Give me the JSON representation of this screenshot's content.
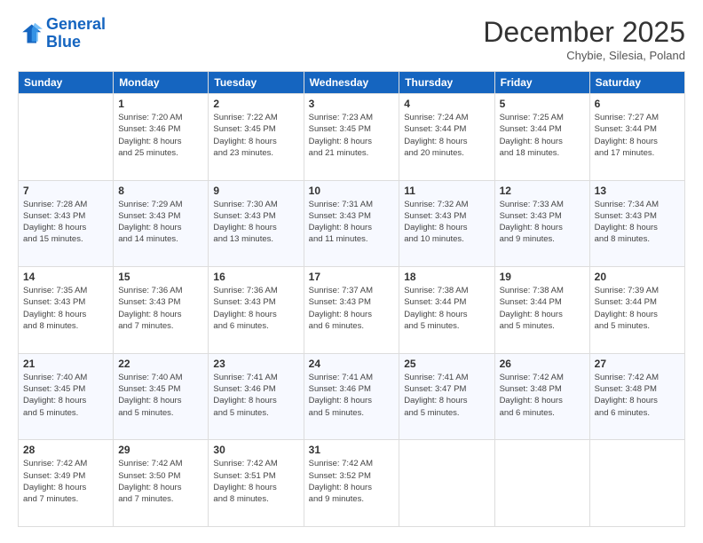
{
  "header": {
    "logo_line1": "General",
    "logo_line2": "Blue",
    "month_title": "December 2025",
    "location": "Chybie, Silesia, Poland"
  },
  "weekdays": [
    "Sunday",
    "Monday",
    "Tuesday",
    "Wednesday",
    "Thursday",
    "Friday",
    "Saturday"
  ],
  "weeks": [
    [
      {
        "day": "",
        "info": ""
      },
      {
        "day": "1",
        "info": "Sunrise: 7:20 AM\nSunset: 3:46 PM\nDaylight: 8 hours\nand 25 minutes."
      },
      {
        "day": "2",
        "info": "Sunrise: 7:22 AM\nSunset: 3:45 PM\nDaylight: 8 hours\nand 23 minutes."
      },
      {
        "day": "3",
        "info": "Sunrise: 7:23 AM\nSunset: 3:45 PM\nDaylight: 8 hours\nand 21 minutes."
      },
      {
        "day": "4",
        "info": "Sunrise: 7:24 AM\nSunset: 3:44 PM\nDaylight: 8 hours\nand 20 minutes."
      },
      {
        "day": "5",
        "info": "Sunrise: 7:25 AM\nSunset: 3:44 PM\nDaylight: 8 hours\nand 18 minutes."
      },
      {
        "day": "6",
        "info": "Sunrise: 7:27 AM\nSunset: 3:44 PM\nDaylight: 8 hours\nand 17 minutes."
      }
    ],
    [
      {
        "day": "7",
        "info": "Sunrise: 7:28 AM\nSunset: 3:43 PM\nDaylight: 8 hours\nand 15 minutes."
      },
      {
        "day": "8",
        "info": "Sunrise: 7:29 AM\nSunset: 3:43 PM\nDaylight: 8 hours\nand 14 minutes."
      },
      {
        "day": "9",
        "info": "Sunrise: 7:30 AM\nSunset: 3:43 PM\nDaylight: 8 hours\nand 13 minutes."
      },
      {
        "day": "10",
        "info": "Sunrise: 7:31 AM\nSunset: 3:43 PM\nDaylight: 8 hours\nand 11 minutes."
      },
      {
        "day": "11",
        "info": "Sunrise: 7:32 AM\nSunset: 3:43 PM\nDaylight: 8 hours\nand 10 minutes."
      },
      {
        "day": "12",
        "info": "Sunrise: 7:33 AM\nSunset: 3:43 PM\nDaylight: 8 hours\nand 9 minutes."
      },
      {
        "day": "13",
        "info": "Sunrise: 7:34 AM\nSunset: 3:43 PM\nDaylight: 8 hours\nand 8 minutes."
      }
    ],
    [
      {
        "day": "14",
        "info": "Sunrise: 7:35 AM\nSunset: 3:43 PM\nDaylight: 8 hours\nand 8 minutes."
      },
      {
        "day": "15",
        "info": "Sunrise: 7:36 AM\nSunset: 3:43 PM\nDaylight: 8 hours\nand 7 minutes."
      },
      {
        "day": "16",
        "info": "Sunrise: 7:36 AM\nSunset: 3:43 PM\nDaylight: 8 hours\nand 6 minutes."
      },
      {
        "day": "17",
        "info": "Sunrise: 7:37 AM\nSunset: 3:43 PM\nDaylight: 8 hours\nand 6 minutes."
      },
      {
        "day": "18",
        "info": "Sunrise: 7:38 AM\nSunset: 3:44 PM\nDaylight: 8 hours\nand 5 minutes."
      },
      {
        "day": "19",
        "info": "Sunrise: 7:38 AM\nSunset: 3:44 PM\nDaylight: 8 hours\nand 5 minutes."
      },
      {
        "day": "20",
        "info": "Sunrise: 7:39 AM\nSunset: 3:44 PM\nDaylight: 8 hours\nand 5 minutes."
      }
    ],
    [
      {
        "day": "21",
        "info": "Sunrise: 7:40 AM\nSunset: 3:45 PM\nDaylight: 8 hours\nand 5 minutes."
      },
      {
        "day": "22",
        "info": "Sunrise: 7:40 AM\nSunset: 3:45 PM\nDaylight: 8 hours\nand 5 minutes."
      },
      {
        "day": "23",
        "info": "Sunrise: 7:41 AM\nSunset: 3:46 PM\nDaylight: 8 hours\nand 5 minutes."
      },
      {
        "day": "24",
        "info": "Sunrise: 7:41 AM\nSunset: 3:46 PM\nDaylight: 8 hours\nand 5 minutes."
      },
      {
        "day": "25",
        "info": "Sunrise: 7:41 AM\nSunset: 3:47 PM\nDaylight: 8 hours\nand 5 minutes."
      },
      {
        "day": "26",
        "info": "Sunrise: 7:42 AM\nSunset: 3:48 PM\nDaylight: 8 hours\nand 6 minutes."
      },
      {
        "day": "27",
        "info": "Sunrise: 7:42 AM\nSunset: 3:48 PM\nDaylight: 8 hours\nand 6 minutes."
      }
    ],
    [
      {
        "day": "28",
        "info": "Sunrise: 7:42 AM\nSunset: 3:49 PM\nDaylight: 8 hours\nand 7 minutes."
      },
      {
        "day": "29",
        "info": "Sunrise: 7:42 AM\nSunset: 3:50 PM\nDaylight: 8 hours\nand 7 minutes."
      },
      {
        "day": "30",
        "info": "Sunrise: 7:42 AM\nSunset: 3:51 PM\nDaylight: 8 hours\nand 8 minutes."
      },
      {
        "day": "31",
        "info": "Sunrise: 7:42 AM\nSunset: 3:52 PM\nDaylight: 8 hours\nand 9 minutes."
      },
      {
        "day": "",
        "info": ""
      },
      {
        "day": "",
        "info": ""
      },
      {
        "day": "",
        "info": ""
      }
    ]
  ]
}
